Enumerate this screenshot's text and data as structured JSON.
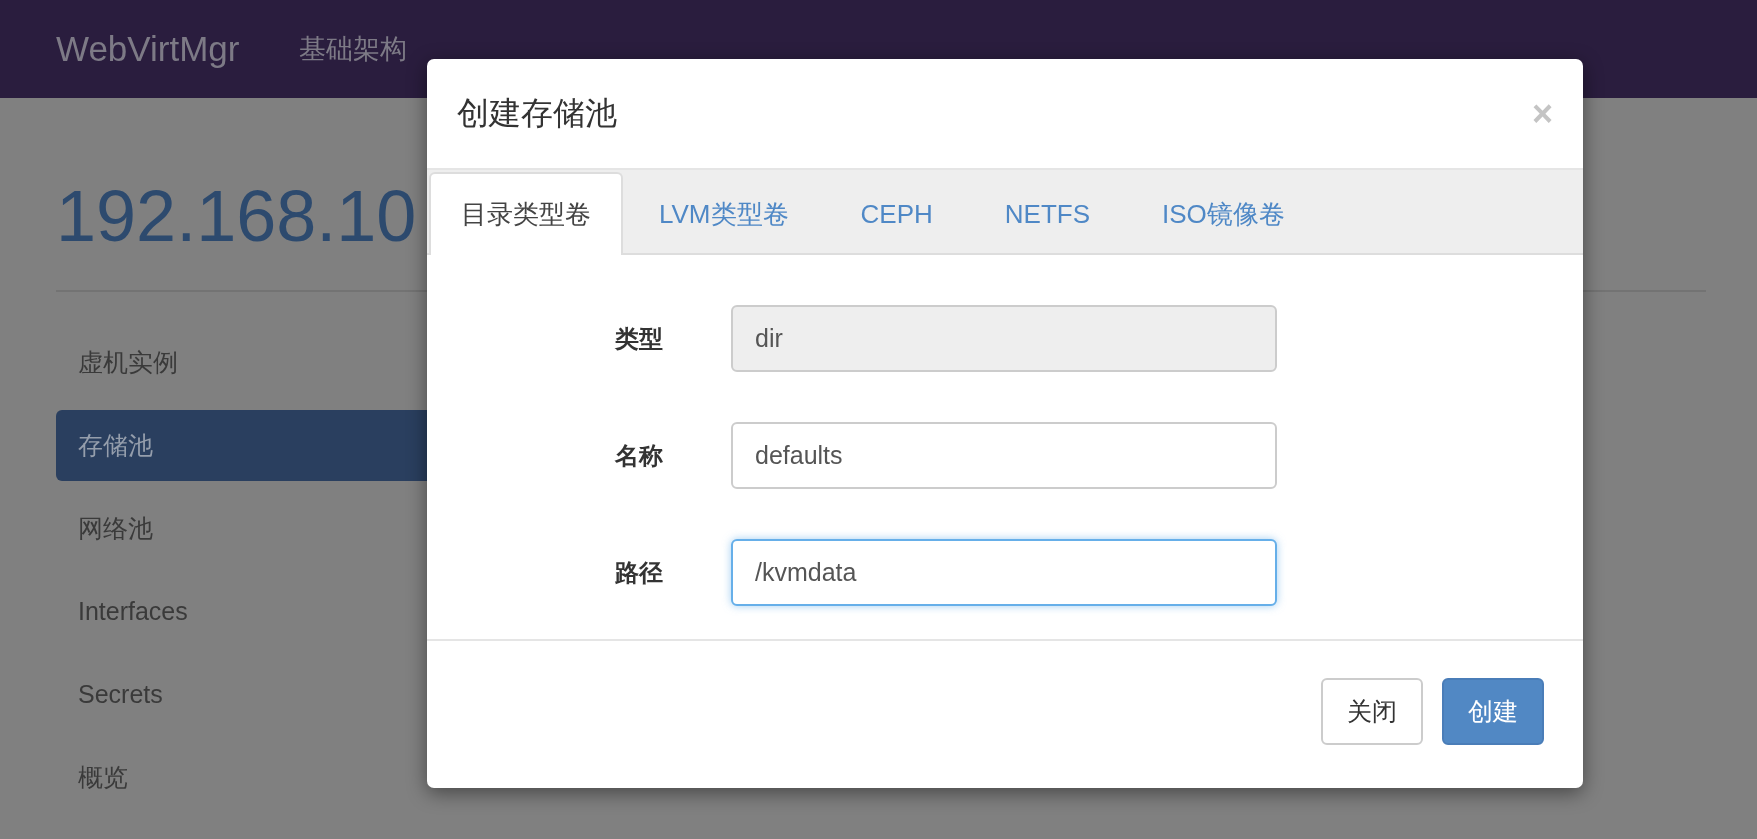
{
  "navbar": {
    "brand": "WebVirtMgr",
    "items": [
      {
        "label": "基础架构"
      }
    ]
  },
  "page": {
    "heading": "192.168.10"
  },
  "sidebar": {
    "items": [
      {
        "label": "虚机实例",
        "selected": false
      },
      {
        "label": "存储池",
        "selected": true
      },
      {
        "label": "网络池",
        "selected": false
      },
      {
        "label": "Interfaces",
        "selected": false
      },
      {
        "label": "Secrets",
        "selected": false
      },
      {
        "label": "概览",
        "selected": false
      }
    ]
  },
  "modal": {
    "title": "创建存储池",
    "close": "×",
    "tabs": [
      {
        "label": "目录类型卷",
        "selected": true
      },
      {
        "label": "LVM类型卷",
        "selected": false
      },
      {
        "label": "CEPH",
        "selected": false
      },
      {
        "label": "NETFS",
        "selected": false
      },
      {
        "label": "ISO镜像卷",
        "selected": false
      }
    ],
    "fields": [
      {
        "label": "类型",
        "value": "dir",
        "disabled": true,
        "focused": false
      },
      {
        "label": "名称",
        "value": "defaults",
        "disabled": false,
        "focused": false
      },
      {
        "label": "路径",
        "value": "/kvmdata",
        "disabled": false,
        "focused": true
      }
    ],
    "buttons": [
      {
        "label": "关闭",
        "kind": "default"
      },
      {
        "label": "创建",
        "kind": "primary"
      }
    ]
  }
}
